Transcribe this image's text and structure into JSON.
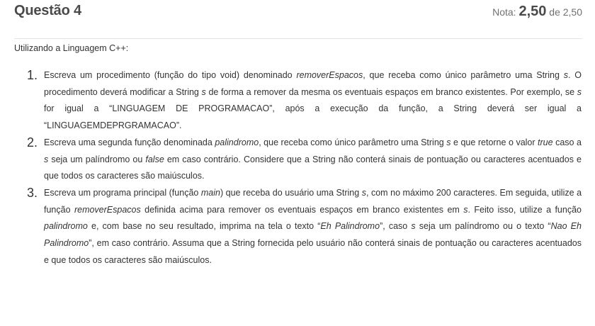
{
  "header": {
    "title": "Questão 4",
    "grade_prefix": "Nota:",
    "grade_value": "2,50",
    "grade_suffix": "de 2,50"
  },
  "intro": "Utilizando a Linguagem C++:",
  "items": [
    {
      "number": "1.",
      "p1": "Escreva um procedimento (função do tipo void) denominado ",
      "e1": "removerEspacos",
      "p2": ", que receba como único parâmetro uma String ",
      "e2": "s",
      "p3": ". O procedimento deverá modificar a String ",
      "e3": "s",
      "p4": " de forma a remover da mesma os eventuais espaços em branco existentes. Por exemplo, se ",
      "e4": "s",
      "p5": " for igual a “LINGUAGEM DE PROGRAMACAO”, após a execução da função, a String deverá ser igual a “LINGUAGEMDEPRGRAMACAO”."
    },
    {
      "number": "2.",
      "p1": "Escreva uma segunda função denominada ",
      "e1": "palindromo",
      "p2": ", que receba como único parâmetro uma String ",
      "e2": "s",
      "p3": " e que retorne o valor ",
      "e3": "true",
      "p4": " caso a ",
      "e4": "s",
      "p5": " seja um palíndromo ou ",
      "e5": "false",
      "p6": " em caso contrário. Considere que a String não conterá sinais de pontuação ou caracteres acentuados e que todos os caracteres são maiúsculos."
    },
    {
      "number": "3.",
      "p1": "Escreva um programa principal (função ",
      "e1": "main",
      "p2": ") que receba do usuário uma String ",
      "e2": "s",
      "p3": ", com no máximo 200 caracteres. Em seguida, utilize a função ",
      "e3": "removerEspacos",
      "p4": " definida acima para remover os eventuais espaços em branco existentes em ",
      "e4": "s",
      "p5": ". Feito isso, utilize a função ",
      "e5": "palindromo",
      "p6": " e, com base no seu resultado, imprima na tela o texto “",
      "e6": "Eh Palindromo",
      "p7": "”, caso ",
      "e7": "s",
      "p8": " seja um palíndromo ou o texto “",
      "e8": "Nao Eh Palindromo",
      "p9": "”, em caso contrário. Assuma que a String fornecida pelo usuário não conterá sinais de pontuação ou caracteres acentuados e que todos os caracteres são maiúsculos."
    }
  ]
}
